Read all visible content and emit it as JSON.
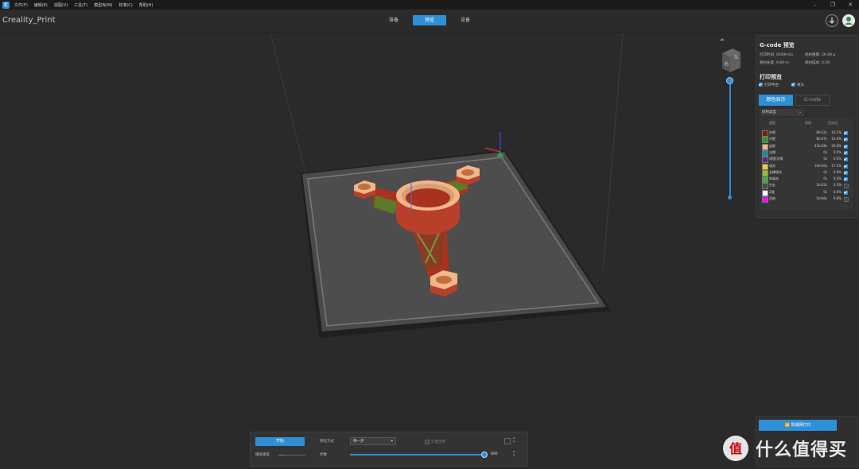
{
  "menubar": {
    "items": [
      "文件(F)",
      "编辑(E)",
      "视图(V)",
      "工具(T)",
      "模型库(M)",
      "校准(C)",
      "帮助(H)"
    ]
  },
  "app": {
    "title": "Creality_Print"
  },
  "tabs": [
    {
      "label": "准备",
      "active": false
    },
    {
      "label": "预览",
      "active": true
    },
    {
      "label": "设备",
      "active": false
    }
  ],
  "gcode_panel": {
    "title": "G-code 预览",
    "print_time": "打印时间: 0h59m5s",
    "filament_weight": "耗材重量: 29.49 g",
    "filament_length": "耗材长度: 9.89 m",
    "filament_cost": "耗材成本: 0.59",
    "preview_title": "打印预览",
    "show_platform": "打印平台",
    "show_nozzle": "喷头",
    "mode_color": "颜色显示",
    "mode_gcode": "G-code",
    "structure_type": "结构类型",
    "col_type": "类型",
    "col_time": "时间",
    "col_pct": "百分比",
    "legend": [
      {
        "name": "外壁",
        "time": "8m22s",
        "pct": "14.2%",
        "color": "#7a1f12",
        "checked": true
      },
      {
        "name": "内壁",
        "time": "8m37s",
        "pct": "14.6%",
        "color": "#1fa01f",
        "checked": true
      },
      {
        "name": "皮肤",
        "time": "23m28s",
        "pct": "39.8%",
        "color": "#f3b58a",
        "checked": true
      },
      {
        "name": "支撑",
        "time": "0s",
        "pct": "0.0%",
        "color": "#1c8aa3",
        "checked": true
      },
      {
        "name": "裙摆/边缘",
        "time": "0s",
        "pct": "0.0%",
        "color": "#5a2a78",
        "checked": true
      },
      {
        "name": "填充",
        "time": "10m10s",
        "pct": "17.4%",
        "color": "#e8d23a",
        "checked": true
      },
      {
        "name": "支撑填充",
        "time": "0s",
        "pct": "0.0%",
        "color": "#9ac21c",
        "checked": true
      },
      {
        "name": "斜填充",
        "time": "0s",
        "pct": "0.0%",
        "color": "#3fb13f",
        "checked": true
      },
      {
        "name": "空走",
        "time": "2m32s",
        "pct": "4.3%",
        "color": "#4a4a4a",
        "checked": false
      },
      {
        "name": "Z缝",
        "time": "0s",
        "pct": "0.0%",
        "color": "#ffffff",
        "checked": true
      },
      {
        "name": "回抽",
        "time": "5m46s",
        "pct": "9.8%",
        "color": "#ff00ff",
        "checked": false
      }
    ]
  },
  "bottom_bar": {
    "start_label": "开始",
    "speed_label": "播放速度",
    "preview_mode_label": "预览方式",
    "preview_mode_value": "每一步",
    "only_step_label": "只显示步",
    "step_label": "步数",
    "step_value": "800",
    "step_progress": 1.0
  },
  "wifi": {
    "button_label": "局域网打印"
  },
  "watermark": {
    "text": "什么值得买"
  },
  "colors": {
    "accent": "#2f8fd6",
    "background": "#2a2a2b",
    "model_red": "#b23a2a",
    "model_skin": "#f3b58a"
  }
}
